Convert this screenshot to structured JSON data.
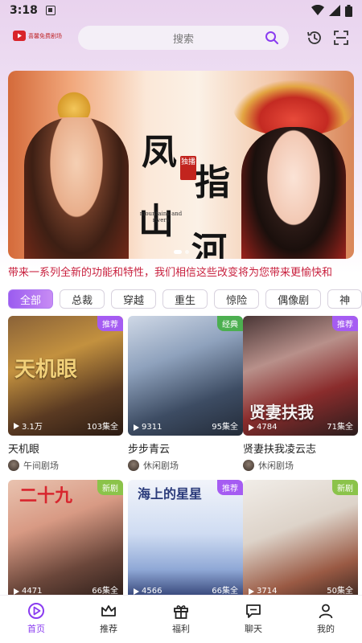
{
  "status_bar": {
    "time": "3:18"
  },
  "header": {
    "logo_text": "喜馨免费剧场",
    "search_placeholder": "搜索"
  },
  "banner": {
    "title_chars": [
      "凤",
      "指",
      "山",
      "河"
    ],
    "seal_text": "独播",
    "english": "mountains and rivers",
    "slide_count": 2,
    "active_slide": 1
  },
  "marquee_text": "带来一系列全新的功能和特性，我们相信这些改变将为您带来更愉快和",
  "categories": [
    {
      "label": "全部",
      "active": true
    },
    {
      "label": "总裁",
      "active": false
    },
    {
      "label": "穿越",
      "active": false
    },
    {
      "label": "重生",
      "active": false
    },
    {
      "label": "惊险",
      "active": false
    },
    {
      "label": "偶像剧",
      "active": false
    },
    {
      "label": "神",
      "active": false
    }
  ],
  "dramas": [
    {
      "title": "天机眼",
      "poster_text": "天机眼",
      "tag": "推荐",
      "tag_color": "#a55cf2",
      "views": "3.1万",
      "episodes": "103集全",
      "source": "午间剧场",
      "poster_colors": [
        "#6b4a2a",
        "#c38a3a",
        "#2a1a12"
      ]
    },
    {
      "title": "步步青云",
      "poster_text": "",
      "tag": "经典",
      "tag_color": "#4caf50",
      "views": "9311",
      "episodes": "95集全",
      "source": "休闲剧场",
      "poster_colors": [
        "#4a5d78",
        "#b8c6d8",
        "#2a3342"
      ]
    },
    {
      "title": "贤妻扶我凌云志",
      "poster_text": "贤妻扶我",
      "tag": "推荐",
      "tag_color": "#a55cf2",
      "views": "4784",
      "episodes": "71集全",
      "source": "休闲剧场",
      "poster_colors": [
        "#3a2a2a",
        "#c9a6a0",
        "#7a2626"
      ]
    },
    {
      "title": "",
      "poster_text": "二十九",
      "tag": "新剧",
      "tag_color": "#8bc34a",
      "views": "4471",
      "episodes": "66集全",
      "source": "",
      "poster_colors": [
        "#d8a58e",
        "#f1d4c6",
        "#5a3a2e"
      ]
    },
    {
      "title": "",
      "poster_text": "海上的星星",
      "tag": "推荐",
      "tag_color": "#a55cf2",
      "views": "4566",
      "episodes": "66集全",
      "source": "",
      "poster_colors": [
        "#2b3a6e",
        "#8fa8d6",
        "#cfdcf2"
      ]
    },
    {
      "title": "",
      "poster_text": "",
      "tag": "新剧",
      "tag_color": "#8bc34a",
      "views": "3714",
      "episodes": "50集全",
      "source": "",
      "poster_colors": [
        "#e8e3de",
        "#cfc3b8",
        "#8a3a2a"
      ]
    }
  ],
  "tabs": [
    {
      "label": "首页",
      "icon": "play-circle-icon",
      "active": true
    },
    {
      "label": "推荐",
      "icon": "crown-icon",
      "active": false
    },
    {
      "label": "福利",
      "icon": "gift-icon",
      "active": false
    },
    {
      "label": "聊天",
      "icon": "chat-icon",
      "active": false
    },
    {
      "label": "我的",
      "icon": "user-icon",
      "active": false
    }
  ]
}
